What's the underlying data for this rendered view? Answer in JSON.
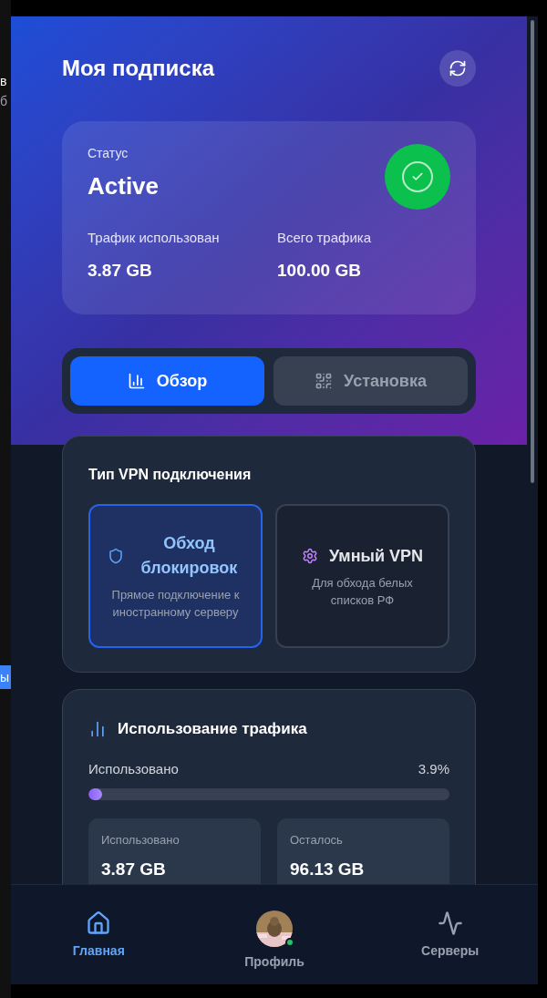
{
  "backdrop": {
    "fragments": [
      {
        "text": "в",
        "kind": "heading"
      },
      {
        "text": "б",
        "kind": "sub"
      },
      {
        "text": "ы",
        "kind": "chip"
      }
    ]
  },
  "header": {
    "title": "Моя подписка"
  },
  "status": {
    "label": "Статус",
    "value": "Active",
    "active": true,
    "stats": [
      {
        "label": "Трафик использован",
        "value": "3.87 GB"
      },
      {
        "label": "Всего трафика",
        "value": "100.00 GB"
      }
    ]
  },
  "tabs": [
    {
      "label": "Обзор",
      "selected": true
    },
    {
      "label": "Установка",
      "selected": false
    }
  ],
  "vpn_type": {
    "title": "Тип VPN подключения",
    "options": [
      {
        "title": "Обход блокировок",
        "description": "Прямое подключение к иностранному серверу",
        "selected": true
      },
      {
        "title": "Умный VPN",
        "description": "Для обхода белых списков РФ",
        "selected": false
      }
    ]
  },
  "traffic": {
    "title": "Использование трафика",
    "used_label": "Использовано",
    "percent": "3.9%",
    "level": 0.039,
    "stats": [
      {
        "label": "Использовано",
        "value": "3.87 GB"
      },
      {
        "label": "Осталось",
        "value": "96.13 GB"
      }
    ]
  },
  "nav": [
    {
      "label": "Главная",
      "selected": true,
      "kind": "icon"
    },
    {
      "label": "Профиль",
      "selected": false,
      "kind": "avatar",
      "online": true
    },
    {
      "label": "Серверы",
      "selected": false,
      "kind": "icon"
    }
  ]
}
